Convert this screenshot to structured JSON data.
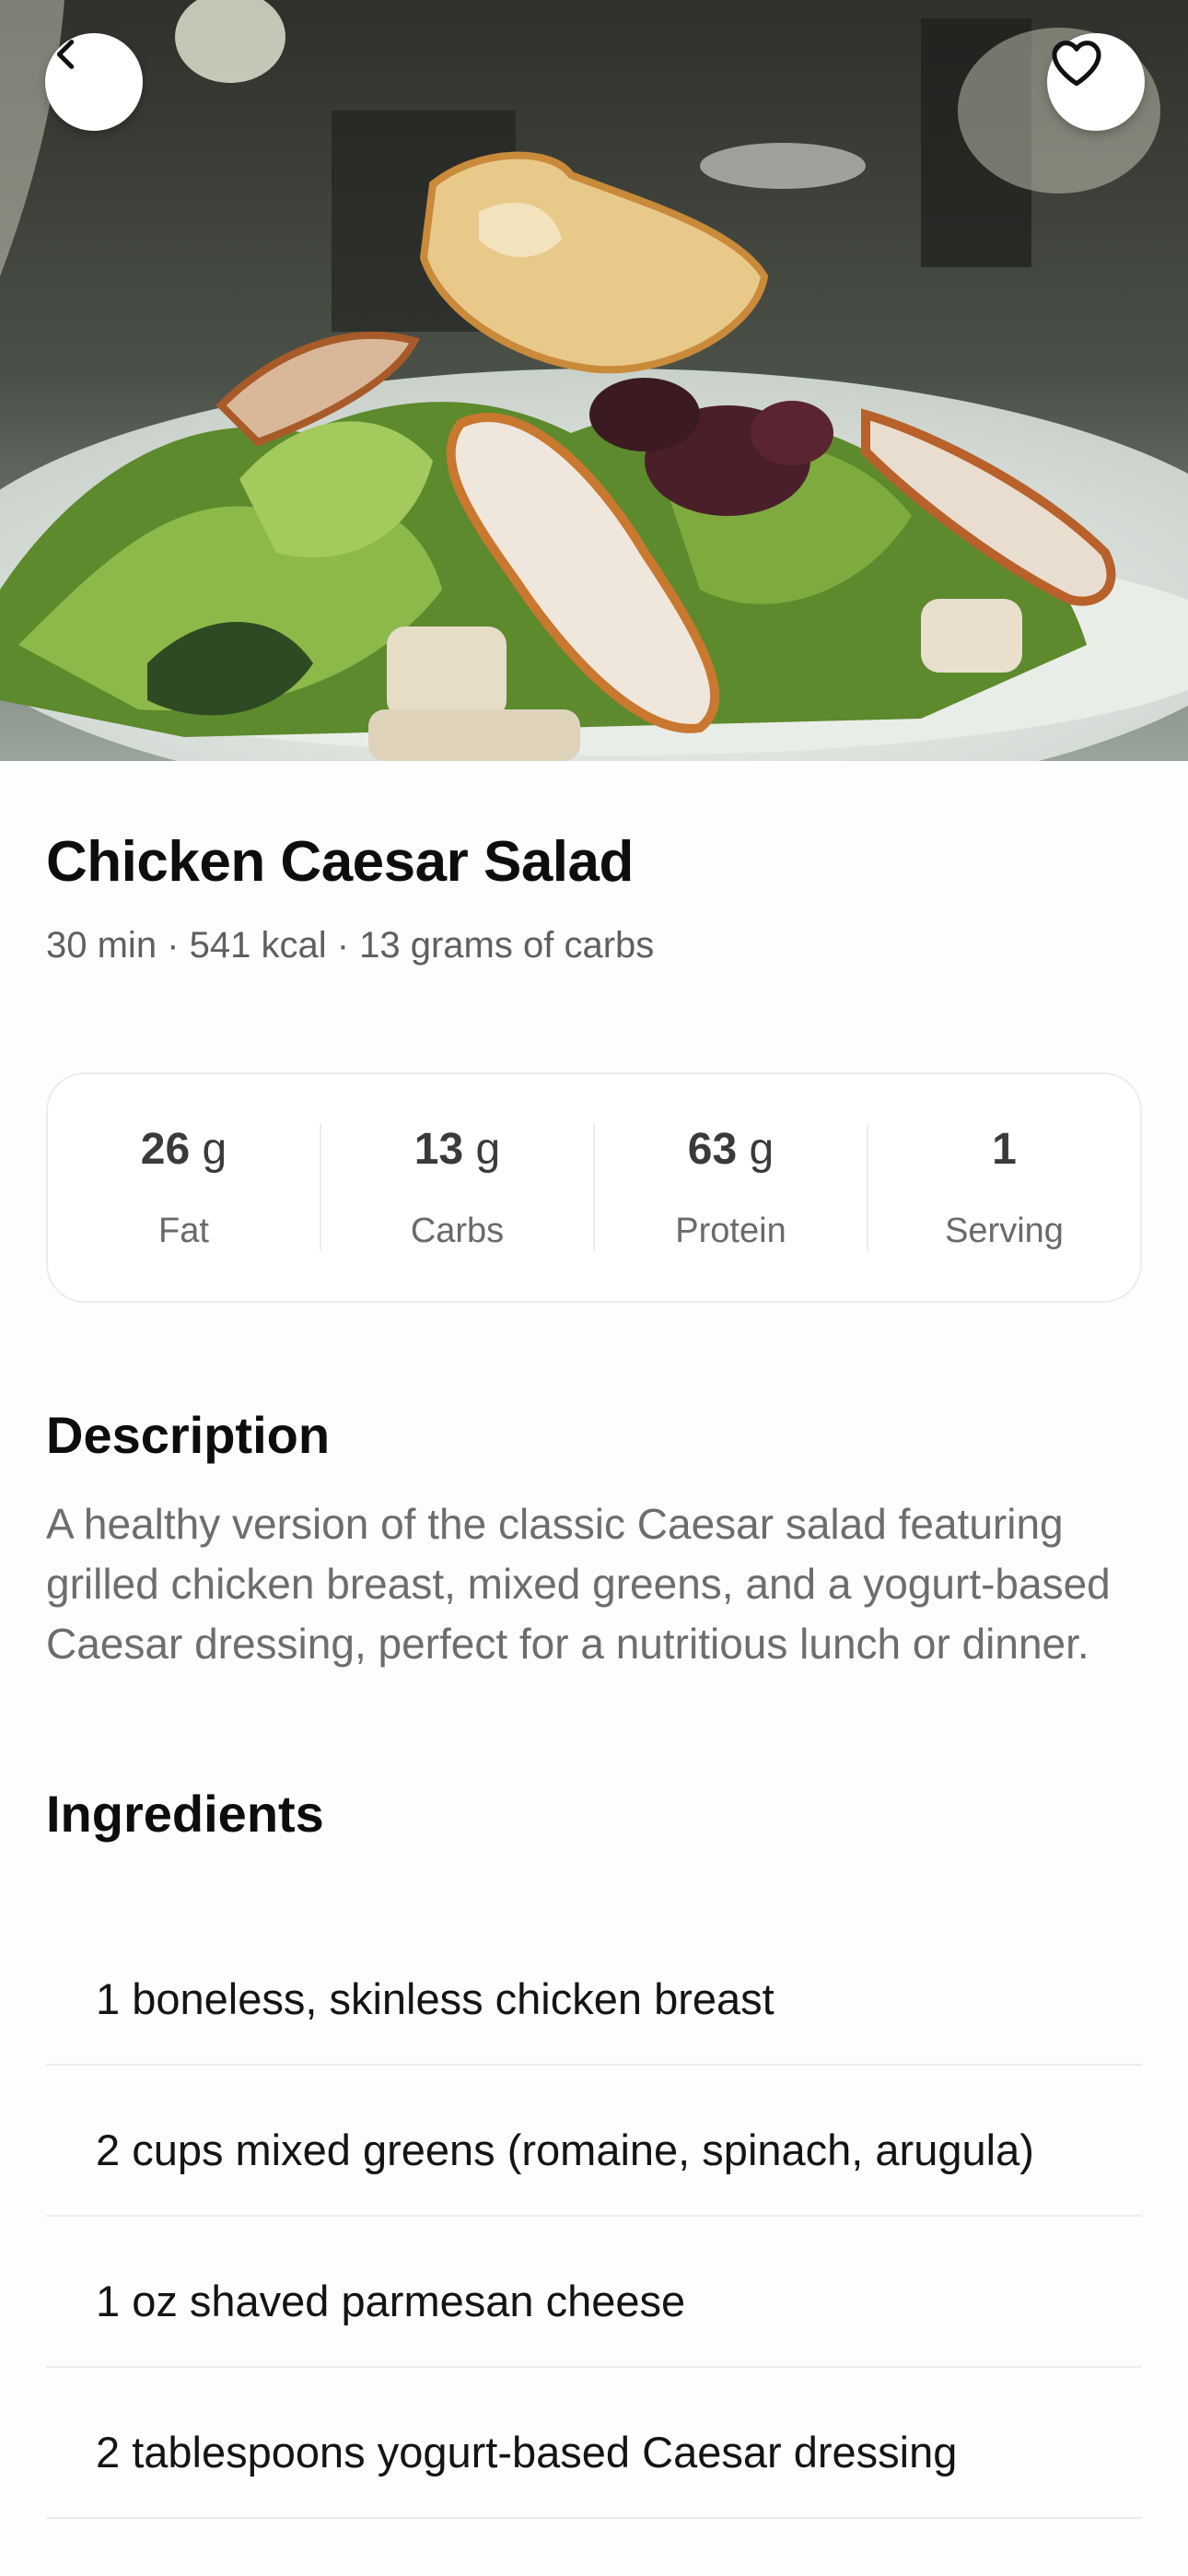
{
  "header": {
    "back_icon": "chevron-left-icon",
    "favorite_icon": "heart-outline-icon"
  },
  "recipe": {
    "title": "Chicken Caesar Salad",
    "meta": "30 min · 541 kcal · 13 grams of carbs"
  },
  "nutrition": [
    {
      "value": "26",
      "unit": "g",
      "label": "Fat"
    },
    {
      "value": "13",
      "unit": "g",
      "label": "Carbs"
    },
    {
      "value": "63",
      "unit": "g",
      "label": "Protein"
    },
    {
      "value": "1",
      "unit": "",
      "label": "Serving"
    }
  ],
  "description": {
    "heading": "Description",
    "text": "A healthy version of the classic Caesar salad featuring grilled chicken breast, mixed greens, and a yogurt-based Caesar dressing, perfect for a nutritious lunch or dinner."
  },
  "ingredients": {
    "heading": "Ingredients",
    "items": [
      "1 boneless, skinless chicken breast",
      "2 cups mixed greens (romaine, spinach, arugula)",
      "1 oz shaved parmesan cheese",
      "2 tablespoons yogurt-based Caesar dressing"
    ]
  },
  "colors": {
    "background": "#fdfdfd",
    "title": "#0d0d0d",
    "muted_text": "#6d6d6d",
    "divider": "#ececec"
  }
}
